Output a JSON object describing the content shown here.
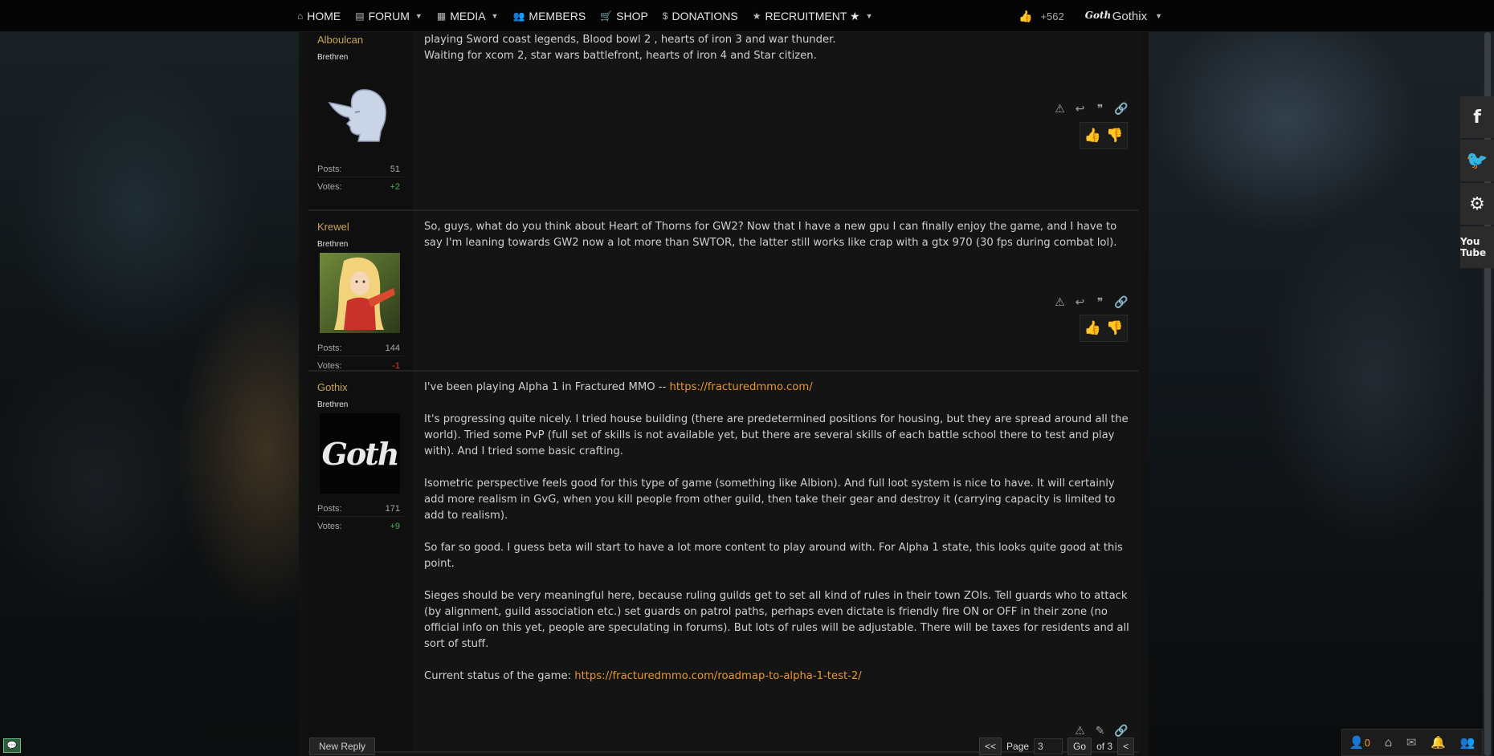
{
  "nav": {
    "home": "HOME",
    "forum": "FORUM",
    "media": "MEDIA",
    "members": "MEMBERS",
    "shop": "SHOP",
    "donations": "DONATIONS",
    "recruitment": "RECRUITMENT ★",
    "rep": "+562",
    "username": "Gothix",
    "avatar_text": "Goth"
  },
  "labels": {
    "posts": "Posts:",
    "votes": "Votes:"
  },
  "posts": [
    {
      "author": "Alboulcan",
      "rank": "Brethren",
      "posts": "51",
      "votes": "+2",
      "lines": [
        "playing Sword coast legends, Blood bowl 2 , hearts of iron 3 and war thunder.",
        "Waiting for xcom 2, star wars battlefront, hearts of iron 4 and Star citizen."
      ]
    },
    {
      "author": "Krewel",
      "rank": "Brethren",
      "posts": "144",
      "votes": "-1",
      "text": "So, guys, what do you think about Heart of Thorns for GW2? Now that I have a new gpu I can finally enjoy the game, and I have to say I'm leaning towards GW2 now a lot more than SWTOR, the latter still works like crap with a gtx 970 (30 fps during combat lol)."
    },
    {
      "author": "Gothix",
      "rank": "Brethren",
      "posts": "171",
      "votes": "+9",
      "avatar_text": "Goth",
      "p1_text": "I've been playing Alpha 1 in Fractured MMO -- ",
      "p1_link": "https://fracturedmmo.com/",
      "p2": "It's progressing quite nicely. I tried house building (there are predetermined positions for housing, but they are spread around all the world). Tried some PvP (full set of skills is not available yet, but there are several skills of each battle school there to test and play with). And I tried some basic crafting.",
      "p3": "Isometric perspective feels good for this type of game (something like Albion). And full loot system is nice to have. It will certainly add more realism in GvG, when you kill people from other guild, then take their gear and destroy it (carrying capacity is limited to add to realism).",
      "p4": "So far so good. I guess beta will start to have a lot more content to play around with. For Alpha 1 state, this looks quite good at this point.",
      "p5": "Sieges should be very meaningful here, because ruling guilds get to set all kind of rules in their town ZOIs. Tell guards who to attack (by alignment, guild association etc.) set guards on patrol paths, perhaps even dictate is friendly fire ON or OFF in their zone (no official info on this yet, people are speculating in forums). But lots of rules will be adjustable. There will be taxes for residents and all sort of stuff.",
      "p6_text": "Current status of the game: ",
      "p6_link": "https://fracturedmmo.com/roadmap-to-alpha-1-test-2/"
    }
  ],
  "footer": {
    "new_reply": "New Reply",
    "first": "<<",
    "page_label": "Page",
    "page_value": "3",
    "go": "Go",
    "of": "of 3",
    "prev": "<",
    "notif_count": "0"
  },
  "social": {
    "youtube": "You Tube"
  },
  "colors": {
    "accent_link": "#e8952e",
    "username": "#c9a45a",
    "vote_positive": "#4caf50",
    "vote_negative": "#e23b3b"
  }
}
